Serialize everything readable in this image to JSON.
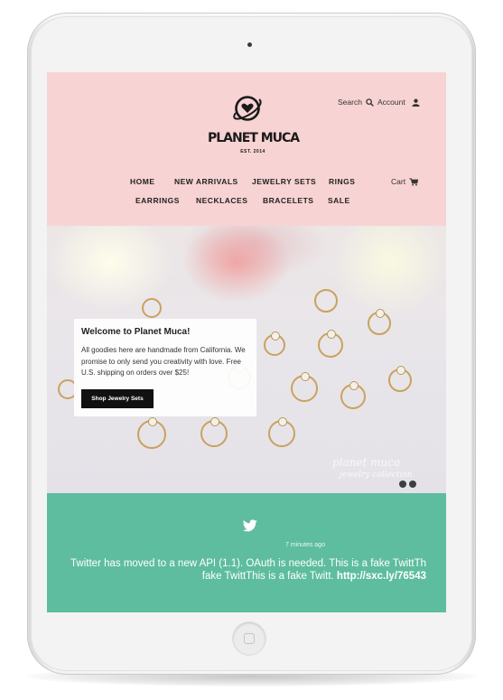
{
  "brand": {
    "name": "PLANET MUCA",
    "est": "EST. 2014"
  },
  "header": {
    "search_label": "Search",
    "account_label": "Account",
    "cart_label": "Cart"
  },
  "nav": {
    "items": [
      {
        "label": "HOME"
      },
      {
        "label": "NEW ARRIVALS"
      },
      {
        "label": "JEWELRY SETS"
      },
      {
        "label": "RINGS"
      },
      {
        "label": "EARRINGS"
      },
      {
        "label": "NECKLACES"
      },
      {
        "label": "BRACELETS"
      },
      {
        "label": "SALE"
      }
    ]
  },
  "hero": {
    "title": "Welcome to Planet Muca!",
    "description": "All goodies here are handmade from California. We promise to only send you creativity with love. Free U.S. shipping on orders over $25!",
    "button_label": "Shop Jewelry Sets",
    "watermark_line1": "planet muca",
    "watermark_line2": "jewelry collection"
  },
  "twitter": {
    "time": "7 minutes ago",
    "text": "Twitter has moved to a new API (1.1). OAuth is needed. This is a fake TwittTh fake TwittThis is a fake Twitt.",
    "link": "http://sxc.ly/76543"
  },
  "icons": {
    "logo": "planet-heart-icon",
    "search": "search-icon",
    "account": "user-icon",
    "cart": "cart-icon",
    "twitter": "twitter-bird-icon"
  },
  "colors": {
    "header_bg": "#f8d3d3",
    "twitter_bg": "#5ebd9e",
    "button_bg": "#111111",
    "text_dark": "#222222"
  }
}
